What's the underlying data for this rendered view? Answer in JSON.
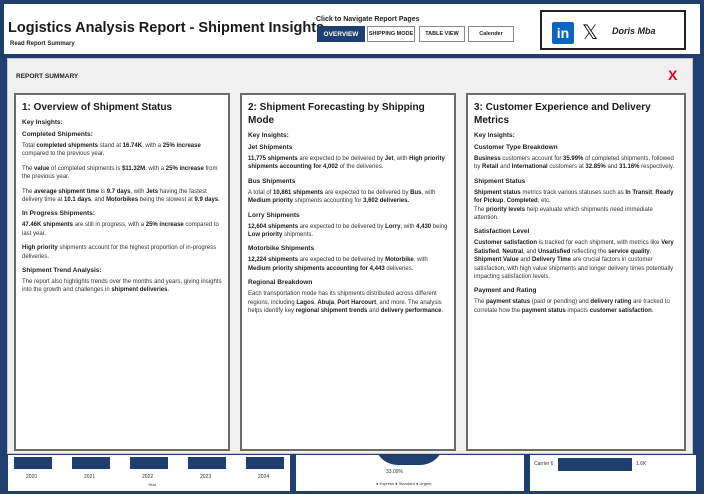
{
  "header": {
    "title": "Logistics Analysis Report - Shipment Insights",
    "subtitle": "Read Report Summary",
    "nav_label": "Click to Navigate Report Pages",
    "nav_buttons": [
      "OVERVIEW",
      "SHIPPING MODE",
      "TABLE VIEW",
      "Calender"
    ],
    "profile_name": "Doris Mba",
    "icons": [
      "linkedin-icon",
      "x-twitter-icon"
    ]
  },
  "background": {
    "years": [
      "2020",
      "2021",
      "2022",
      "2023",
      "2024"
    ],
    "year_axis_label": "Year",
    "donut_percent": "33.09%",
    "legend": "● Express ● Standard ● Urgent",
    "carrier_label": "Carrier 6",
    "carrier_value": "1.6K",
    "colors": {
      "navy": "#1f3f70",
      "close_red": "#e0001b",
      "linkedin": "#0a66c2"
    }
  },
  "modal": {
    "label": "REPORT SUMMARY",
    "close": "X",
    "card1": {
      "title": "1: Overview of Shipment Status",
      "key_insights": "Key Insights:",
      "completed_head": "Completed Shipments",
      "completed_head_suffix": ":",
      "c1_a": "Total ",
      "c1_b": "completed shipments",
      "c1_c": " stand at ",
      "c1_d": "16.74K",
      "c1_e": ", with a ",
      "c1_f": "25% increase",
      "c1_g": " compared to the previous year.",
      "c2_a": "The ",
      "c2_b": "value",
      "c2_c": " of completed shipments is ",
      "c2_d": "$11.32M",
      "c2_e": ", with a ",
      "c2_f": "25% increase",
      "c2_g": " from the previous year.",
      "c3_a": "The ",
      "c3_b": "average shipment time",
      "c3_c": " is ",
      "c3_d": "9.7 days",
      "c3_e": ", with ",
      "c3_f": "Jets",
      "c3_g": " having the fastest delivery time at ",
      "c3_h": "10.1 days",
      "c3_i": ", and ",
      "c3_j": "Motorbikes",
      "c3_k": " being the slowest at ",
      "c3_l": "9.9 days",
      "c3_m": ".",
      "progress_head": "In Progress Shipments",
      "progress_head_suffix": ":",
      "p1_a": "47.46K shipments",
      "p1_b": " are still in progress, with a ",
      "p1_c": "25% increase",
      "p1_d": " compared to last year.",
      "p2_a": "High priority",
      "p2_b": " shipments account for the highest proportion of in-progress deliveries.",
      "trend_head": "Shipment Trend Analysis",
      "trend_head_suffix": ":",
      "t1_a": "The report also highlights trends over the months and years, giving insights into the growth and challenges in ",
      "t1_b": "shipment deliveries",
      "t1_c": "."
    },
    "card2": {
      "title": "2: Shipment Forecasting by Shipping Mode",
      "key_insights": "Key Insights:",
      "jet_head": "Jet Shipments",
      "jet_a": "11,775 shipments",
      "jet_b": " are expected to be delivered by ",
      "jet_c": "Jet",
      "jet_d": ", with ",
      "jet_e": "High priority shipments accounting for 4,002",
      "jet_f": " of the deliveries.",
      "bus_head": "Bus Shipments",
      "bus_a": "A total of ",
      "bus_b": "10,861 shipments",
      "bus_c": " are expected to be delivered by ",
      "bus_d": "Bus",
      "bus_e": ", with ",
      "bus_f": "Medium priority",
      "bus_g": " shipments accounting for ",
      "bus_h": "3,602 deliveries.",
      "lorry_head": "Lorry Shipments",
      "lorry_a": "12,604 shipments",
      "lorry_b": " are expected to be delivered by ",
      "lorry_c": "Lorry",
      "lorry_d": ", with ",
      "lorry_e": "4,430",
      "lorry_f": " being ",
      "lorry_g": "Low priority",
      "lorry_h": " shipments.",
      "moto_head": "Motorbike Shipments",
      "moto_a": "12,224 shipments",
      "moto_b": " are expected to be delivered by ",
      "moto_c": "Motorbike",
      "moto_d": ", with ",
      "moto_e": "Medium priority shipments accounting for 4,443",
      "moto_f": " deliveries.",
      "region_head": "Regional Breakdown",
      "region_a": "Each transportation mode has its shipments distributed across different regions, including ",
      "region_b": "Lagos",
      "region_c": ", ",
      "region_d": "Abuja",
      "region_e": ", ",
      "region_f": "Port Harcourt",
      "region_g": ", and more. The analysis helps identify key ",
      "region_h": "regional shipment trends",
      "region_i": " and ",
      "region_j": "delivery performance",
      "region_k": "."
    },
    "card3": {
      "title": "3: Customer Experience and Delivery Metrics",
      "key_insights": "Key Insights:",
      "type_head": "Customer Type Breakdown",
      "type_a": "Business",
      "type_b": " customers account for ",
      "type_c": "35.99%",
      "type_d": " of completed shipments, followed by ",
      "type_e": "Retail",
      "type_f": " and ",
      "type_g": "International",
      "type_h": " customers at ",
      "type_i": "32.85%",
      "type_j": " and ",
      "type_k": "31.16%",
      "type_l": " respectively.",
      "status_head": "Shipment Status",
      "status_a": "Shipment status",
      "status_b": " metrics track various statuses such as ",
      "status_c": "In Transit",
      "status_d": ", ",
      "status_e": "Ready for Pickup",
      "status_f": ", ",
      "status_g": "Completed",
      "status_h": ", etc.",
      "status_i": "The ",
      "status_j": "priority levels",
      "status_k": " help evaluate which shipments need immediate attention.",
      "sat_head": "Satisfaction Level",
      "sat_a": "Customer satisfaction",
      "sat_b": " is tracked for each shipment, with metrics like ",
      "sat_c": "Very Satisfied",
      "sat_d": ", ",
      "sat_e": "Neutral",
      "sat_f": ", and ",
      "sat_g": "Unsatisfied",
      "sat_h": " reflecting the ",
      "sat_i": "service quality",
      "sat_j": ". ",
      "sat_k": "Shipment Value",
      "sat_l": " and ",
      "sat_m": "Delivery Time",
      "sat_n": " are crucial factors in customer satisfaction, with high value shipments and longer delivery times potentially impacting satisfaction levels.",
      "pay_head": "Payment and Rating",
      "pay_a": "The ",
      "pay_b": "payment status",
      "pay_c": " (paid or pending) and ",
      "pay_d": "delivery rating",
      "pay_e": " are tracked to correlate how the ",
      "pay_f": "payment status",
      "pay_g": " impacts ",
      "pay_h": "customer satisfaction",
      "pay_i": "."
    }
  }
}
